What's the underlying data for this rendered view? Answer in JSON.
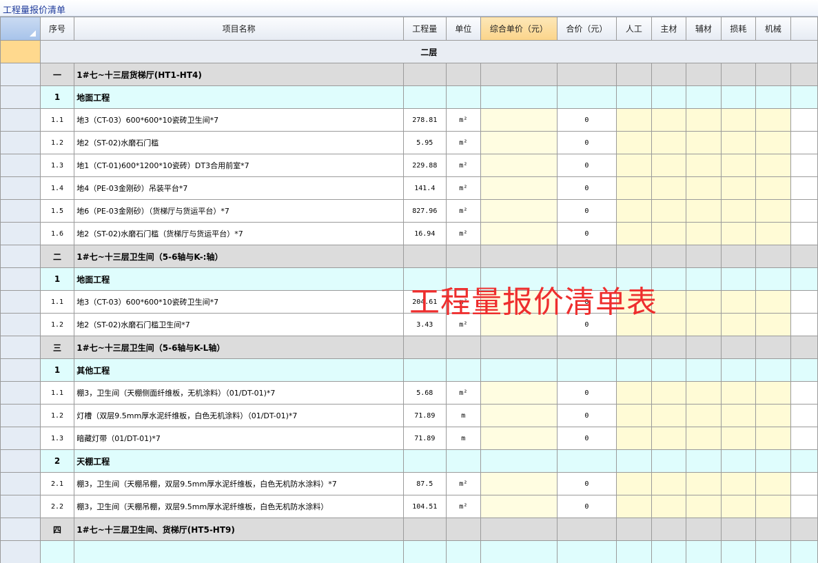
{
  "window_title": "工程量报价清单",
  "watermark": "工程量报价清单表",
  "columns": {
    "seq": "序号",
    "name": "项目名称",
    "qty": "工程量",
    "unit": "单位",
    "unit_price": "综合单价（元）",
    "total": "合价（元）",
    "labor": "人工",
    "main_mat": "主材",
    "aux_mat": "辅材",
    "loss": "损耗",
    "machine": "机械"
  },
  "floor_label": "二层",
  "rows": [
    {
      "type": "band",
      "seq": "一",
      "name": "1#七~十三层货梯厅(HT1-HT4)"
    },
    {
      "type": "sub",
      "seq": "1",
      "name": "地面工程"
    },
    {
      "type": "item",
      "seq": "1.1",
      "name": "地3（CT-03）600*600*10瓷砖卫生间*7",
      "qty": "278.81",
      "unit": "m²",
      "total": "0"
    },
    {
      "type": "item",
      "seq": "1.2",
      "name": "地2（ST-02)水磨石门槛",
      "qty": "5.95",
      "unit": "m²",
      "total": "0"
    },
    {
      "type": "item",
      "seq": "1.3",
      "name": "地1（CT-01)600*1200*10瓷砖）DT3合用前室*7",
      "qty": "229.88",
      "unit": "m²",
      "total": "0"
    },
    {
      "type": "item",
      "seq": "1.4",
      "name": "地4（PE-03金刚砂）吊装平台*7",
      "qty": "141.4",
      "unit": "m²",
      "total": "0"
    },
    {
      "type": "item",
      "seq": "1.5",
      "name": "地6（PE-03金刚砂）（货梯厅与货运平台）*7",
      "qty": "827.96",
      "unit": "m²",
      "total": "0"
    },
    {
      "type": "item",
      "seq": "1.6",
      "name": "地2（ST-02)水磨石门槛（货梯厅与货运平台）*7",
      "qty": "16.94",
      "unit": "m²",
      "total": "0"
    },
    {
      "type": "band",
      "seq": "二",
      "name": "1#七~十三层卫生间（5-6轴与K-:轴）"
    },
    {
      "type": "sub",
      "seq": "1",
      "name": "地面工程"
    },
    {
      "type": "item",
      "seq": "1.1",
      "name": "地3（CT-03）600*600*10瓷砖卫生间*7",
      "qty": "204.61",
      "unit": "m²",
      "total": "0"
    },
    {
      "type": "item",
      "seq": "1.2",
      "name": "地2（ST-02)水磨石门槛卫生间*7",
      "qty": "3.43",
      "unit": "m²",
      "total": "0"
    },
    {
      "type": "band",
      "seq": "三",
      "name": "1#七~十三层卫生间（5-6轴与K-L轴）"
    },
    {
      "type": "sub",
      "seq": "1",
      "name": "其他工程"
    },
    {
      "type": "item",
      "seq": "1.1",
      "name": "棚3，卫生间（天棚侧面纤维板，无机涂料）（01/DT-01)*7",
      "qty": "5.68",
      "unit": "m²",
      "total": "0"
    },
    {
      "type": "item",
      "seq": "1.2",
      "name": "灯槽（双层9.5mm厚水泥纤维板，白色无机涂料）（01/DT-01)*7",
      "qty": "71.89",
      "unit": "m",
      "total": "0"
    },
    {
      "type": "item",
      "seq": "1.3",
      "name": "暗藏灯带（01/DT-01)*7",
      "qty": "71.89",
      "unit": "m",
      "total": "0"
    },
    {
      "type": "sub",
      "seq": "2",
      "name": "天棚工程"
    },
    {
      "type": "item",
      "seq": "2.1",
      "name": "棚3，卫生间（天棚吊棚，双层9.5mm厚水泥纤维板，白色无机防水涂料）*7",
      "qty": "87.5",
      "unit": "m²",
      "total": "0"
    },
    {
      "type": "item",
      "seq": "2.2",
      "name": "棚3，卫生间（天棚吊棚，双层9.5mm厚水泥纤维板，白色无机防水涂料）",
      "qty": "104.51",
      "unit": "m²",
      "total": "0"
    },
    {
      "type": "band",
      "seq": "四",
      "name": "1#七~十三层卫生间、货梯厅(HT5-HT9)"
    },
    {
      "type": "sub",
      "seq": "",
      "name": ""
    }
  ]
}
